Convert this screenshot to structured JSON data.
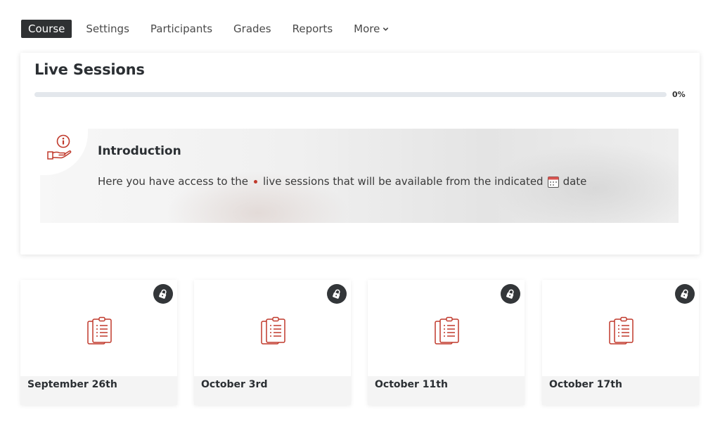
{
  "nav": {
    "items": [
      {
        "label": "Course",
        "active": true
      },
      {
        "label": "Settings",
        "active": false
      },
      {
        "label": "Participants",
        "active": false
      },
      {
        "label": "Grades",
        "active": false
      },
      {
        "label": "Reports",
        "active": false
      }
    ],
    "more_label": "More"
  },
  "page": {
    "title": "Live Sessions",
    "progress_percent": 0,
    "progress_label": "0%"
  },
  "intro": {
    "title": "Introduction",
    "text_part1": "Here you have access to the",
    "text_part2": "live sessions that will be available from the indicated",
    "text_part3": "date"
  },
  "sessions": [
    {
      "label": "September 26th",
      "locked": true
    },
    {
      "label": "October 3rd",
      "locked": true
    },
    {
      "label": "October 11th",
      "locked": true
    },
    {
      "label": "October 17th",
      "locked": true
    }
  ],
  "colors": {
    "accent": "#c0392b",
    "nav_active_bg": "#2f3133",
    "lock_bg": "#333639"
  }
}
